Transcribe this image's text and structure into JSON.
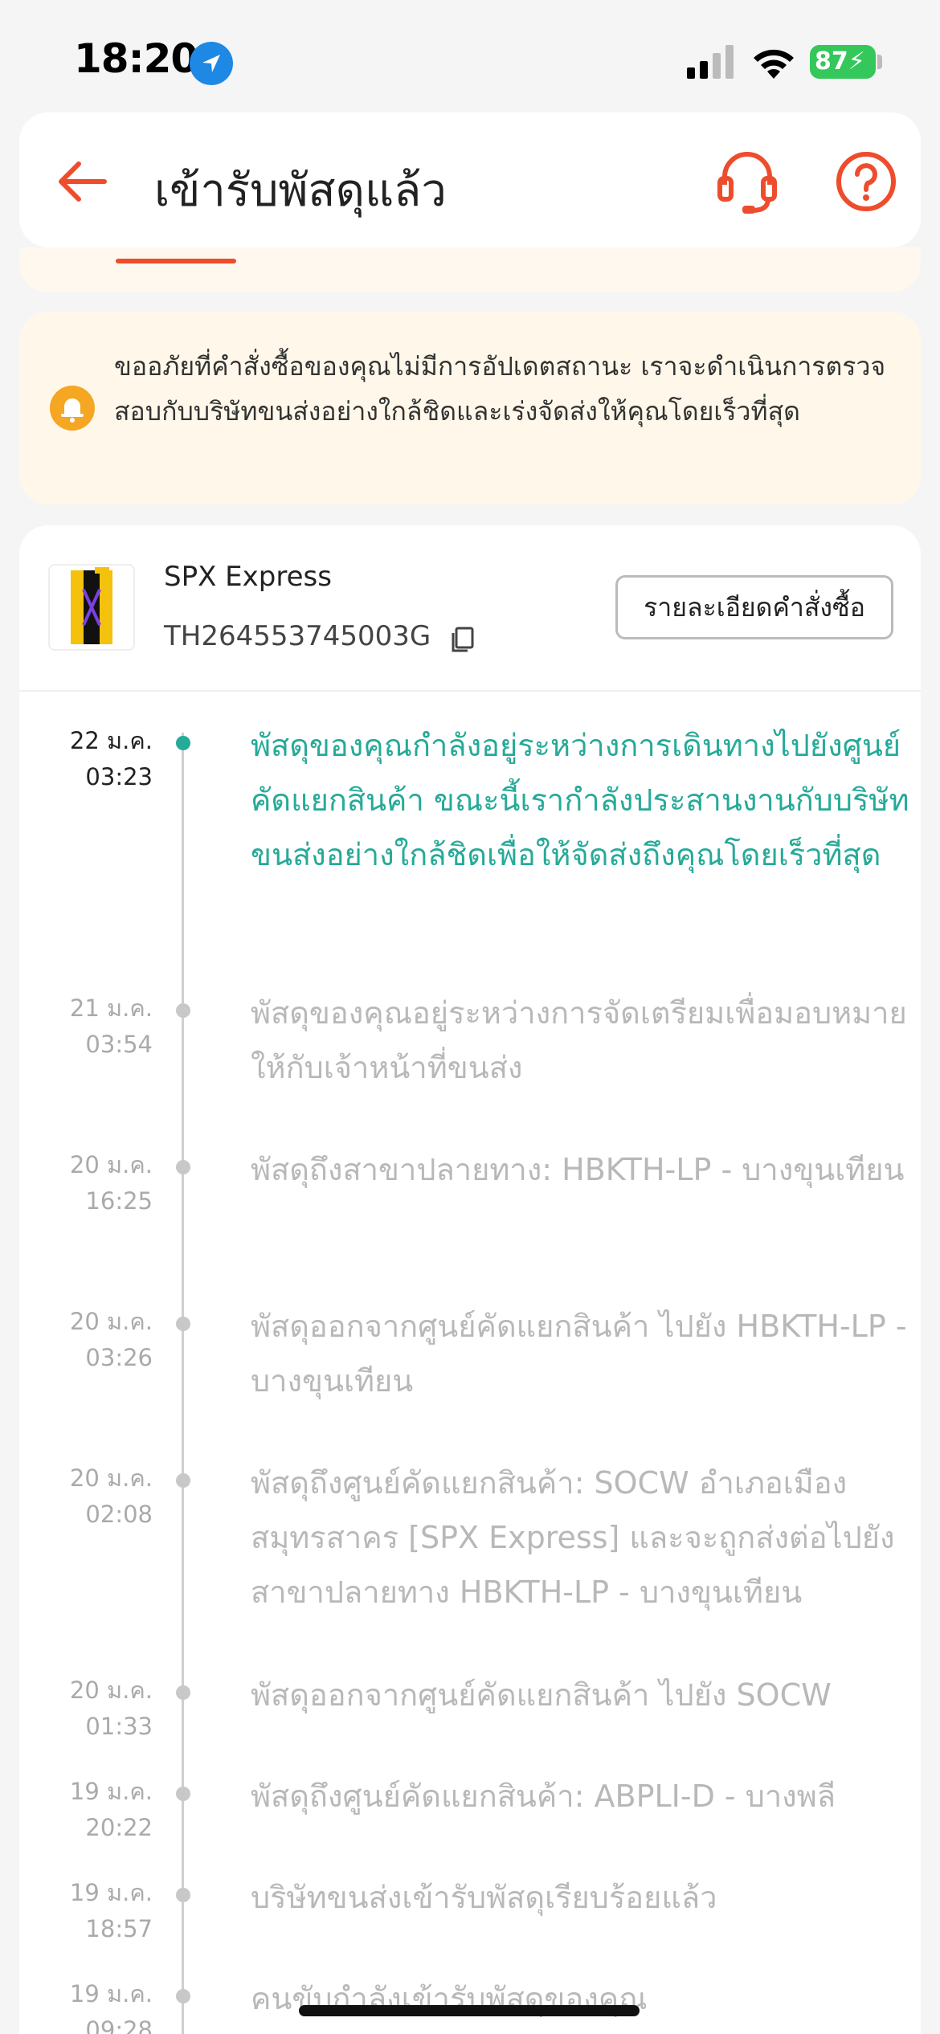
{
  "status_bar": {
    "time": "18:20",
    "battery": "87"
  },
  "header": {
    "title": "เข้ารับพัสดุแล้ว"
  },
  "notice": {
    "text": "ขออภัยที่คำสั่งซื้อของคุณไม่มีการอัปเดตสถานะ เราจะดำเนินการตรวจสอบกับบริษัทขนส่งอย่างใกล้ชิดและเร่งจัดส่งให้คุณโดยเร็วที่สุด"
  },
  "shipment": {
    "carrier": "SPX Express",
    "tracking_number": "TH264553745003G",
    "details_button": "รายละเอียดคำสั่งซื้อ"
  },
  "timeline": [
    {
      "date": "22 ม.ค.",
      "time": "03:23",
      "description": "พัสดุของคุณกำลังอยู่ระหว่างการเดินทางไปยังศูนย์คัดแยกสินค้า ขณะนี้เรากำลังประสานงานกับบริษัทขนส่งอย่างใกล้ชิดเพื่อให้จัดส่งถึงคุณโดยเร็วที่สุด"
    },
    {
      "date": "21 ม.ค.",
      "time": "03:54",
      "description": "พัสดุของคุณอยู่ระหว่างการจัดเตรียมเพื่อมอบหมายให้กับเจ้าหน้าที่ขนส่ง"
    },
    {
      "date": "20 ม.ค.",
      "time": "16:25",
      "description": "พัสดุถึงสาขาปลายทาง: HBKTH-LP - บางขุนเทียน"
    },
    {
      "date": "20 ม.ค.",
      "time": "03:26",
      "description": "พัสดุออกจากศูนย์คัดแยกสินค้า  ไปยัง HBKTH-LP - บางขุนเทียน"
    },
    {
      "date": "20 ม.ค.",
      "time": "02:08",
      "description": "พัสดุถึงศูนย์คัดแยกสินค้า: SOCW อำเภอเมืองสมุทรสาคร [SPX Express] และจะถูกส่งต่อไปยังสาขาปลายทาง HBKTH-LP - บางขุนเทียน"
    },
    {
      "date": "20 ม.ค.",
      "time": "01:33",
      "description": "พัสดุออกจากศูนย์คัดแยกสินค้า ไปยัง SOCW"
    },
    {
      "date": "19 ม.ค.",
      "time": "20:22",
      "description": "พัสดุถึงศูนย์คัดแยกสินค้า: ABPLI-D - บางพลี"
    },
    {
      "date": "19 ม.ค.",
      "time": "18:57",
      "description": "บริษัทขนส่งเข้ารับพัสดุเรียบร้อยแล้ว"
    },
    {
      "date": "19 ม.ค.",
      "time": "09:28",
      "description": "คนขับกำลังเข้ารับพัสดุของคุณ"
    }
  ],
  "colors": {
    "accent": "#ee4d2d",
    "active": "#26aa99",
    "notice_bg": "#fff8ea",
    "bell": "#f5a623"
  }
}
